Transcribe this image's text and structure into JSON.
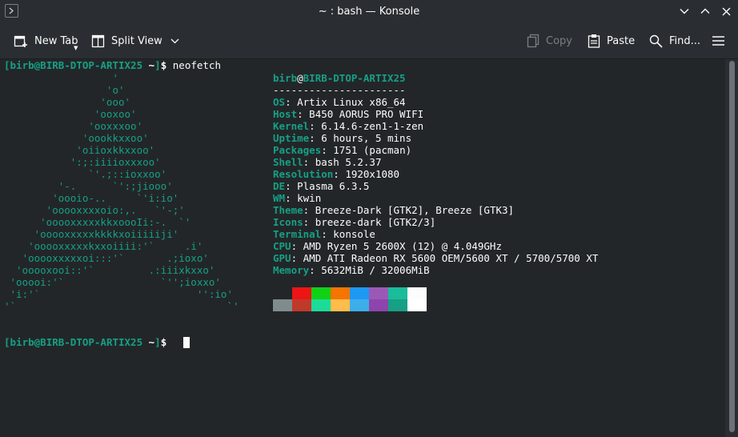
{
  "window": {
    "title": "~ : bash — Konsole"
  },
  "toolbar": {
    "new_tab": "New Tab",
    "split_view": "Split View",
    "copy": "Copy",
    "paste": "Paste",
    "find": "Find..."
  },
  "terminal": {
    "prompt_user": "birb",
    "prompt_host": "BIRB-DTOP-ARTIX25",
    "prompt_dir": "~",
    "command": "neofetch",
    "logo_lines": [
      "                  '",
      "                 'o'",
      "                'ooo'",
      "               'ooxoo'",
      "              'ooxxxoo'",
      "             'oookkxxoo'",
      "            'oiioxkkxxoo'",
      "           ':;:iiiioxxxoo'",
      "              `'.;::ioxxoo'",
      "         '-.      `':;jiooo'",
      "        'oooio-..     `'i:io'",
      "       'ooooxxxxoio:,.   `'-;'",
      "      'ooooxxxxxkkxoooIi:-.  `'",
      "     'ooooxxxxxkkkkxoiiiiiji'",
      "    'ooooxxxxxkxxoiiii:'`     .i'",
      "   'ooooxxxxxoi:::'`       .;ioxo'",
      "  'ooooxooi::'`         .:iiixkxxo'",
      " 'ooooi:'`                `'';ioxxo'",
      " 'i:'`                          '':io'",
      "'`                                   `'"
    ],
    "info_user": "birb",
    "info_host": "BIRB-DTOP-ARTIX25",
    "separator": "----------------------",
    "info": [
      {
        "key": "OS",
        "value": "Artix Linux x86_64"
      },
      {
        "key": "Host",
        "value": "B450 AORUS PRO WIFI"
      },
      {
        "key": "Kernel",
        "value": "6.14.6-zen1-1-zen"
      },
      {
        "key": "Uptime",
        "value": "6 hours, 5 mins"
      },
      {
        "key": "Packages",
        "value": "1751 (pacman)"
      },
      {
        "key": "Shell",
        "value": "bash 5.2.37"
      },
      {
        "key": "Resolution",
        "value": "1920x1080"
      },
      {
        "key": "DE",
        "value": "Plasma 6.3.5"
      },
      {
        "key": "WM",
        "value": "kwin"
      },
      {
        "key": "Theme",
        "value": "Breeze-Dark [GTK2], Breeze [GTK3]"
      },
      {
        "key": "Icons",
        "value": "breeze-dark [GTK2/3]"
      },
      {
        "key": "Terminal",
        "value": "konsole"
      },
      {
        "key": "CPU",
        "value": "AMD Ryzen 5 2600X (12) @ 4.049GHz"
      },
      {
        "key": "GPU",
        "value": "AMD ATI Radeon RX 5600 OEM/5600 XT / 5700/5700 XT"
      },
      {
        "key": "Memory",
        "value": "5632MiB / 32006MiB"
      }
    ],
    "palette_top": [
      "#232629",
      "#ed1515",
      "#11d116",
      "#f67400",
      "#1d99f3",
      "#9b59b6",
      "#1abc9c",
      "#fcfcfc"
    ],
    "palette_bottom": [
      "#7f8c8d",
      "#c0392b",
      "#1cdc9a",
      "#fdbc4b",
      "#3daee9",
      "#8e44ad",
      "#16a085",
      "#ffffff"
    ]
  }
}
